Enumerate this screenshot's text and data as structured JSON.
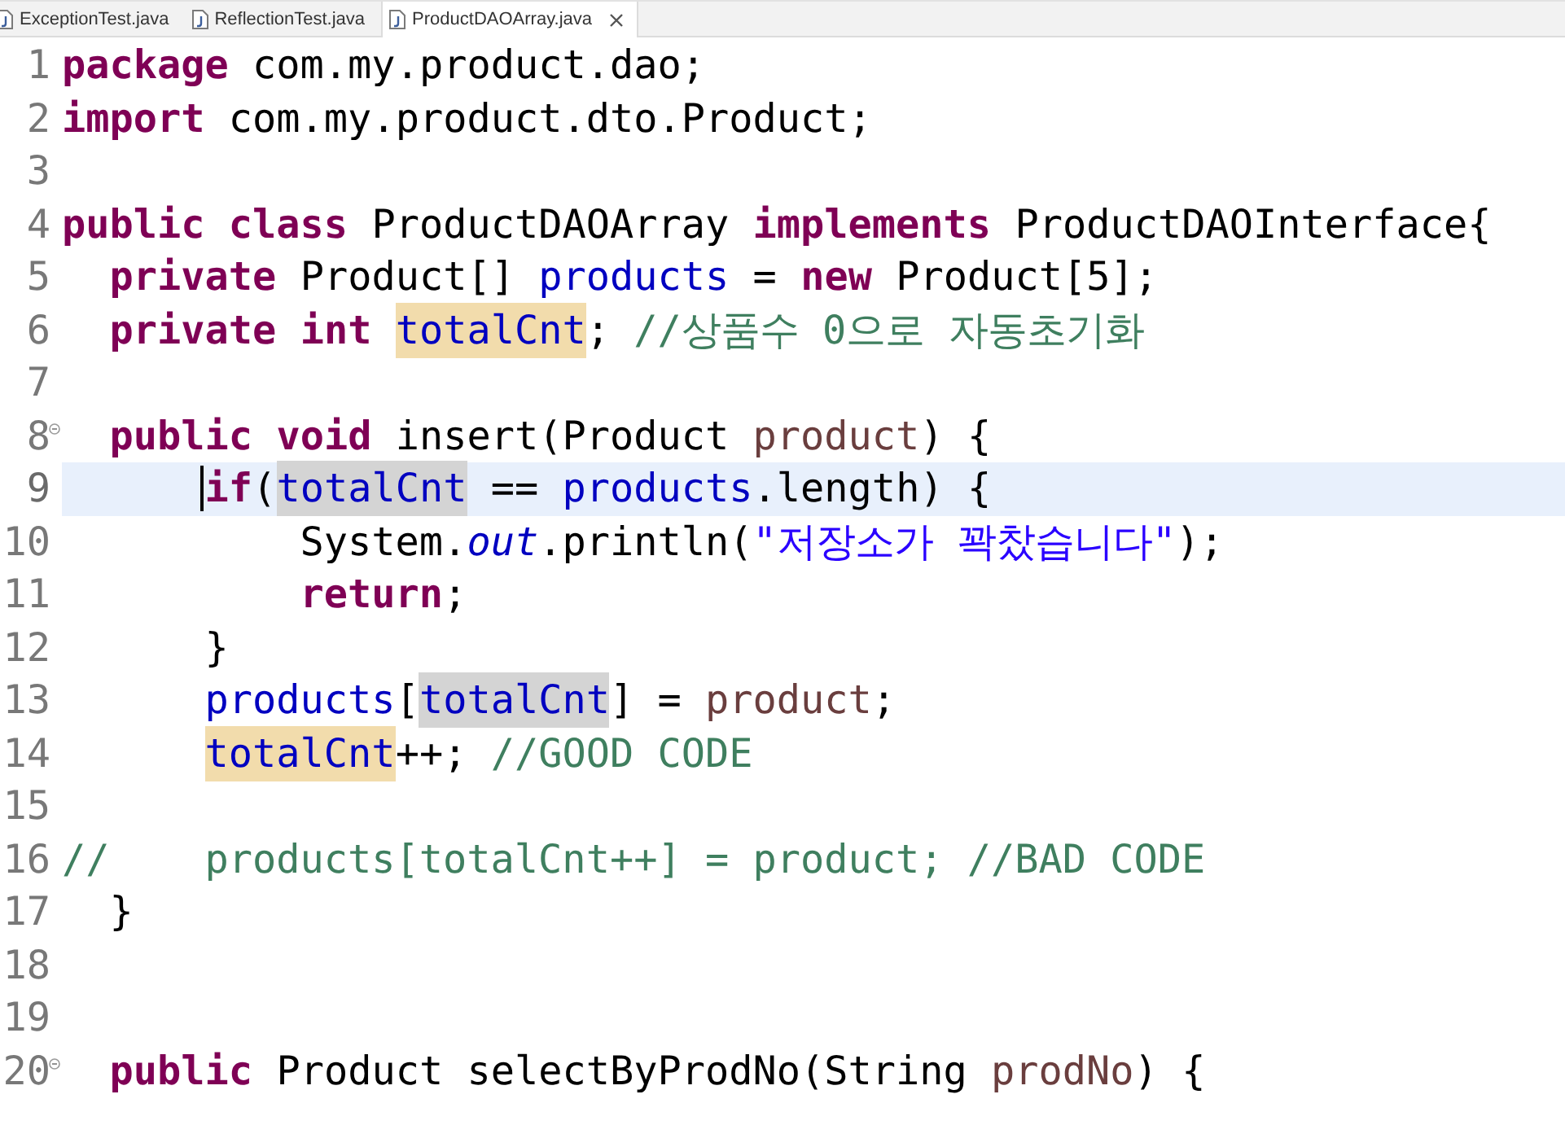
{
  "tabs": [
    {
      "label": "ExceptionTest.java",
      "selected": false
    },
    {
      "label": "ReflectionTest.java",
      "selected": false
    },
    {
      "label": "ProductDAOArray.java",
      "selected": true
    }
  ],
  "lines": [
    {
      "number": "1",
      "fold": false,
      "current": false,
      "segments": [
        {
          "kind": "keyword",
          "text": "package"
        },
        {
          "kind": "plain",
          "text": " com.my.product.dao;"
        }
      ]
    },
    {
      "number": "2",
      "fold": false,
      "current": false,
      "segments": [
        {
          "kind": "keyword",
          "text": "import"
        },
        {
          "kind": "plain",
          "text": " com.my.product.dto.Product;"
        }
      ]
    },
    {
      "number": "3",
      "fold": false,
      "current": false
    },
    {
      "number": "4",
      "fold": false,
      "current": false,
      "segments": [
        {
          "kind": "keyword",
          "text": "public"
        },
        {
          "kind": "keyword",
          "text": " class"
        },
        {
          "kind": "plain",
          "text": " ProductDAOArray"
        },
        {
          "kind": "keyword",
          "text": " implements"
        },
        {
          "kind": "plain",
          "text": " ProductDAOInterface{"
        }
      ]
    },
    {
      "number": "5",
      "fold": false,
      "current": false,
      "segments": [
        {
          "kind": "keyword",
          "text": "  private"
        },
        {
          "kind": "plain",
          "text": " Product[]"
        },
        {
          "kind": "field",
          "text": " products"
        },
        {
          "kind": "plain",
          "text": " ="
        },
        {
          "kind": "keyword",
          "text": " new"
        },
        {
          "kind": "plain",
          "text": " Product[5];"
        }
      ]
    },
    {
      "number": "6",
      "fold": false,
      "current": false,
      "segments": [
        {
          "kind": "keyword",
          "text": "  private"
        },
        {
          "kind": "keyword",
          "text": " int"
        },
        {
          "kind": "field_write_mark",
          "text": " totalCnt"
        },
        {
          "kind": "plain",
          "text": ";"
        },
        {
          "kind": "comment",
          "text": " //상품수 0으로 자동초기화"
        }
      ]
    },
    {
      "number": "7",
      "fold": false,
      "current": false
    },
    {
      "number": "8",
      "fold": true,
      "current": false,
      "segments": [
        {
          "kind": "keyword",
          "text": "  public"
        },
        {
          "kind": "keyword",
          "text": " void"
        },
        {
          "kind": "plain",
          "text": " insert(Product"
        },
        {
          "kind": "param",
          "text": " product"
        },
        {
          "kind": "plain",
          "text": ") {"
        }
      ]
    },
    {
      "number": "9",
      "fold": false,
      "current": true,
      "segments": [
        {
          "kind": "keyword",
          "text": "      if"
        },
        {
          "kind": "plain",
          "text": "("
        },
        {
          "kind": "field_read_mark",
          "text": "totalCnt"
        },
        {
          "kind": "plain",
          "text": " =="
        },
        {
          "kind": "field",
          "text": " products"
        },
        {
          "kind": "plain",
          "text": ".length) {"
        }
      ]
    },
    {
      "number": "10",
      "fold": false,
      "current": false,
      "segments": [
        {
          "kind": "plain",
          "text": "          System."
        },
        {
          "kind": "static",
          "text": "out"
        },
        {
          "kind": "plain",
          "text": ".println("
        },
        {
          "kind": "string",
          "text": "\"저장소가 꽉찼습니다\""
        },
        {
          "kind": "plain",
          "text": ");"
        }
      ]
    },
    {
      "number": "11",
      "fold": false,
      "current": false,
      "segments": [
        {
          "kind": "keyword",
          "text": "          return"
        },
        {
          "kind": "plain",
          "text": ";"
        }
      ]
    },
    {
      "number": "12",
      "fold": false,
      "current": false,
      "segments": [
        {
          "kind": "plain",
          "text": "      }"
        }
      ]
    },
    {
      "number": "13",
      "fold": false,
      "current": false,
      "segments": [
        {
          "kind": "field",
          "text": "      products"
        },
        {
          "kind": "plain",
          "text": "["
        },
        {
          "kind": "field_read_mark",
          "text": "totalCnt"
        },
        {
          "kind": "plain",
          "text": "] ="
        },
        {
          "kind": "param",
          "text": " product"
        },
        {
          "kind": "plain",
          "text": ";"
        }
      ]
    },
    {
      "number": "14",
      "fold": false,
      "current": false,
      "segments": [
        {
          "kind": "field_write_mark",
          "text": "      totalCnt"
        },
        {
          "kind": "plain",
          "text": "++;"
        },
        {
          "kind": "comment",
          "text": " //GOOD CODE"
        }
      ]
    },
    {
      "number": "15",
      "fold": false,
      "current": false
    },
    {
      "number": "16",
      "fold": false,
      "current": false,
      "segments": [
        {
          "kind": "comment",
          "text": "//    products[totalCnt++] = product; //BAD CODE"
        }
      ]
    },
    {
      "number": "17",
      "fold": false,
      "current": false,
      "segments": [
        {
          "kind": "plain",
          "text": "  }"
        }
      ]
    },
    {
      "number": "18",
      "fold": false,
      "current": false
    },
    {
      "number": "19",
      "fold": false,
      "current": false
    },
    {
      "number": "20",
      "fold": true,
      "current": false,
      "segments": [
        {
          "kind": "keyword",
          "text": "  public"
        },
        {
          "kind": "plain",
          "text": " Product selectByProdNo(String"
        },
        {
          "kind": "param",
          "text": " prodNo"
        },
        {
          "kind": "plain",
          "text": ") {"
        }
      ]
    }
  ]
}
